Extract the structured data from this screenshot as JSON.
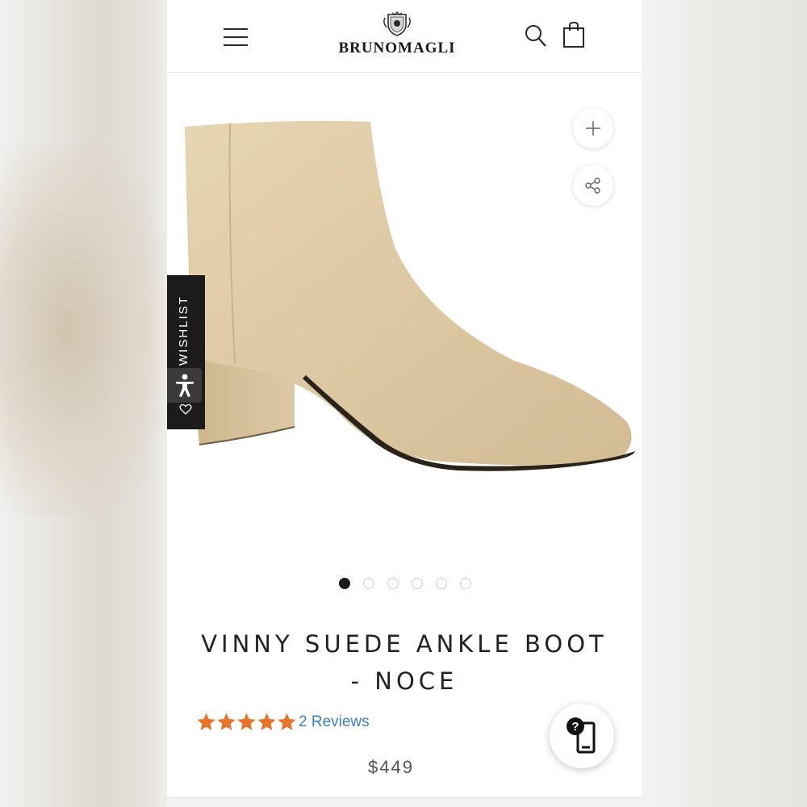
{
  "brand": {
    "name": "BRUNOMAGLI"
  },
  "header": {
    "menu_icon": "hamburger-menu-icon",
    "search_icon": "search-icon",
    "cart_icon": "shopping-bag-icon"
  },
  "gallery": {
    "zoom_icon": "plus-icon",
    "share_icon": "share-icon",
    "slide_count": 6,
    "active_slide": 1
  },
  "wishlist": {
    "label": "WISHLIST",
    "icon": "heart-icon"
  },
  "accessibility": {
    "icon": "accessibility-icon"
  },
  "product": {
    "title_line1": "VINNY SUEDE ANKLE BOOT",
    "title_line2": "- NOCE",
    "rating": 5,
    "rating_max": 5,
    "reviews_label": "2 Reviews",
    "price": "$449"
  },
  "help": {
    "icon": "help-chat-icon",
    "label": "?"
  },
  "colors": {
    "star": "#e8732a",
    "link": "#3b7fc4",
    "suede": "#dcc9a4",
    "dark": "#1b1b1b"
  }
}
